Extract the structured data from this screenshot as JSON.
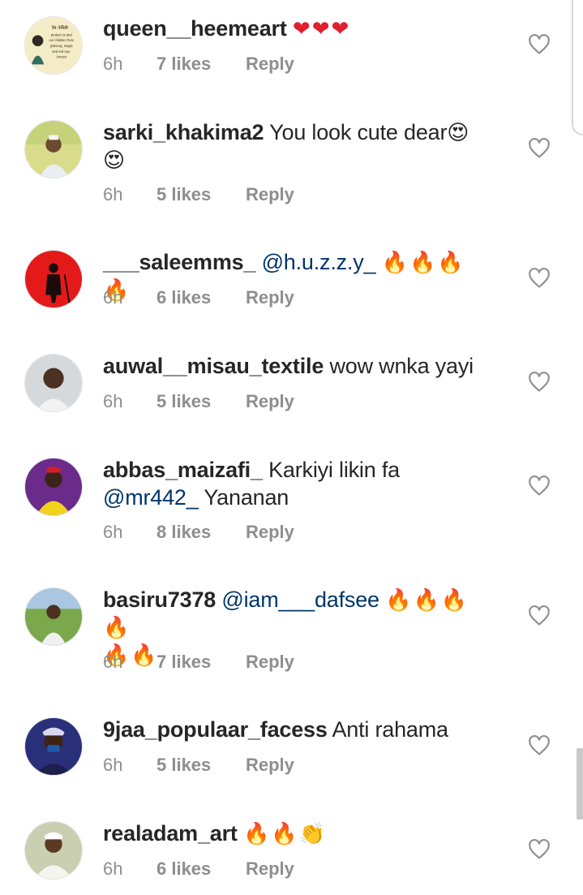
{
  "comments": [
    {
      "username": "queen__heemeart",
      "text": "",
      "mention": "",
      "text_after": "",
      "emoji": "❤❤❤",
      "emoji2": "",
      "time": "6h",
      "likes": "7 likes",
      "reply": "Reply",
      "avatar_text": [
        "Ya Allah",
        "protect us and",
        "our children from",
        "jealousy, magic",
        "and evil eye.",
        "Ameen"
      ]
    },
    {
      "username": "sarki_khakima2",
      "text": " You look cute dear",
      "mention": "",
      "text_after": "",
      "emoji": "😍",
      "emoji2": "😍",
      "time": "6h",
      "likes": "5 likes",
      "reply": "Reply"
    },
    {
      "username": "___saleemms_",
      "text": " ",
      "mention": "@h.u.z.z.y_",
      "text_after": " ",
      "emoji": "🔥🔥🔥🔥",
      "emoji2": "",
      "time": "6h",
      "likes": "6 likes",
      "reply": "Reply"
    },
    {
      "username": "auwal__misau_textile",
      "text": " wow wnka yayi",
      "mention": "",
      "text_after": "",
      "emoji": "",
      "emoji2": "",
      "time": "6h",
      "likes": "5 likes",
      "reply": "Reply"
    },
    {
      "username": "abbas_maizafi_",
      "text": " Karkiyi  likin fa",
      "mention": "@mr442_",
      "text_after": "  Yananan",
      "emoji": "",
      "emoji2": "",
      "time": "6h",
      "likes": "8 likes",
      "reply": "Reply"
    },
    {
      "username": "basiru7378",
      "text": " ",
      "mention": "@iam___dafsee",
      "text_after": " ",
      "emoji": "🔥🔥🔥🔥",
      "emoji2": "🔥🔥",
      "time": "6h",
      "likes": "7 likes",
      "reply": "Reply"
    },
    {
      "username": "9jaa_populaar_facess",
      "text": " Anti rahama",
      "mention": "",
      "text_after": "",
      "emoji": "",
      "emoji2": "",
      "time": "6h",
      "likes": "5 likes",
      "reply": "Reply"
    },
    {
      "username": "realadam_art",
      "text": " ",
      "mention": "",
      "text_after": "",
      "emoji": "🔥🔥👏",
      "emoji2": "",
      "time": "6h",
      "likes": "6 likes",
      "reply": "Reply"
    }
  ],
  "colors": {
    "text": "#262626",
    "meta": "#8e8e8e",
    "mention": "#003569",
    "heart_outline": "#8e8e8e",
    "emoji_heart": "#e0202e"
  },
  "icons": {
    "like": "heart-outline-icon",
    "avatar": "profile-avatar"
  }
}
